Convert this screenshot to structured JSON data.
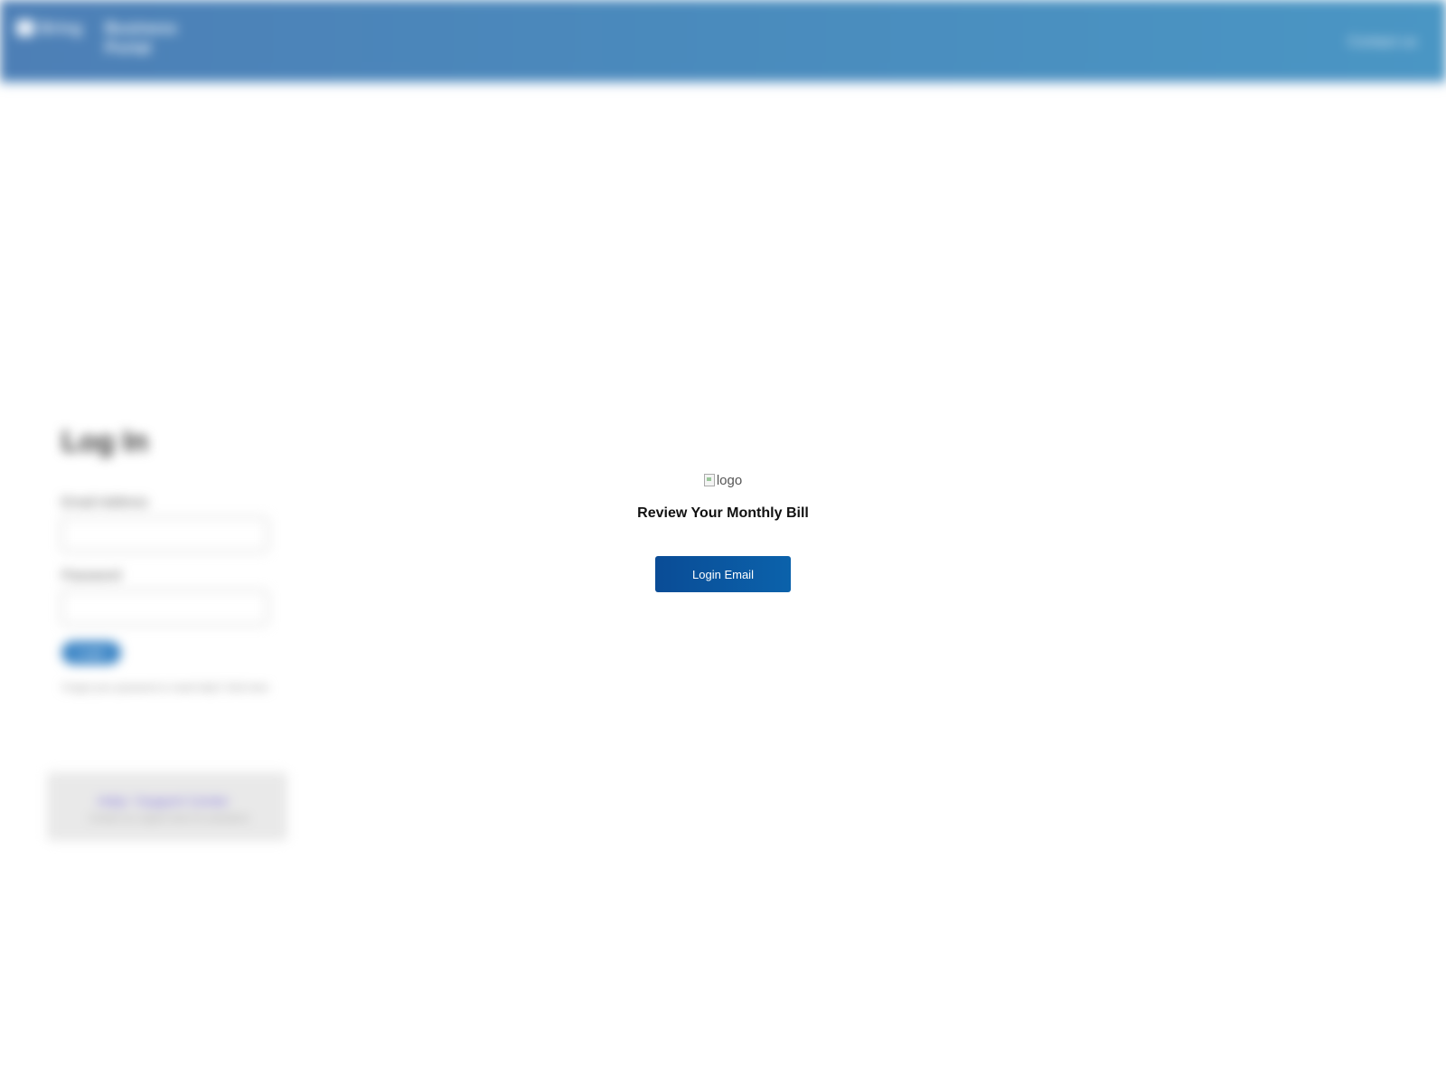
{
  "background": {
    "header": {
      "brand_logo_text": "Bring",
      "brand_name": "Business Portal",
      "right_link": "Contact us"
    },
    "login_panel": {
      "title": "Log In",
      "email_label": "Email Address",
      "password_label": "Password",
      "submit_label": "Login",
      "note": "Forgot your password or need help? Click here"
    },
    "help_box": {
      "link": "Help / Support Center",
      "text": "Contact our support team for assistance"
    }
  },
  "modal": {
    "logo_alt": "logo",
    "title": "Review Your Monthly Bill",
    "button_label": "Login Email"
  },
  "colors": {
    "header_blue": "#4a8bbd",
    "button_blue": "#0b57a1"
  }
}
